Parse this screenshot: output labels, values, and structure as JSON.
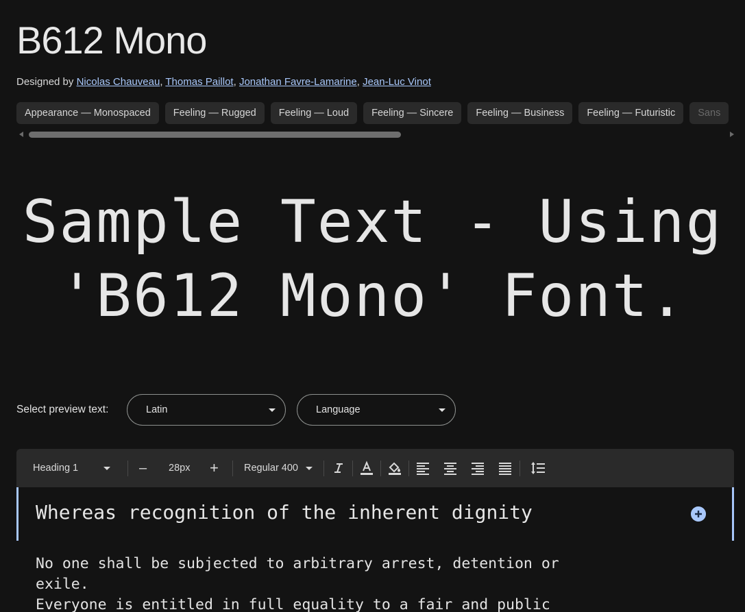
{
  "header": {
    "title": "B612 Mono",
    "designed_by_label": "Designed by",
    "designers": [
      "Nicolas Chauveau",
      "Thomas Paillot",
      "Jonathan Favre-Lamarine",
      "Jean-Luc Vinot"
    ]
  },
  "tags": [
    "Appearance — Monospaced",
    "Feeling — Rugged",
    "Feeling — Loud",
    "Feeling — Sincere",
    "Feeling — Business",
    "Feeling — Futuristic",
    "Sans"
  ],
  "sample": {
    "line1": "Sample Text - Using",
    "line2": "'B612 Mono' Font."
  },
  "preview": {
    "label": "Select preview text:",
    "script_value": "Latin",
    "language_value": "Language"
  },
  "toolbar": {
    "style_value": "Heading 1",
    "decrease_label": "–",
    "size_value": "28px",
    "increase_label": "+",
    "weight_value": "Regular 400"
  },
  "editor": {
    "heading_text": "Whereas recognition of the inherent dignity"
  },
  "body": {
    "lines": [
      "No one shall be subjected to arbitrary arrest, detention or",
      "exile.",
      "Everyone is entitled in full equality to a fair and public"
    ]
  },
  "colors": {
    "background": "#131313",
    "link": "#a8c7fa",
    "accent": "#a8c7fa",
    "chip": "#2a2a2a"
  }
}
